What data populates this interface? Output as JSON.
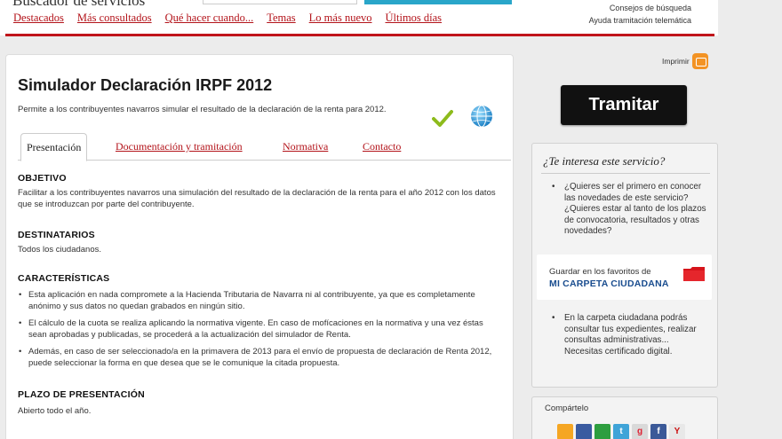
{
  "header": {
    "cut_title": "Buscador de servicios",
    "nav": [
      "Destacados",
      "Más consultados",
      "Qué hacer cuando...",
      "Temas",
      "Lo más nuevo",
      "Últimos días"
    ],
    "links": [
      "Consejos de búsqueda",
      "Ayuda tramitación telemática"
    ]
  },
  "page": {
    "title": "Simulador Declaración IRPF 2012",
    "description": "Permite a los contribuyentes navarros simular el resultado de la declaración de la renta para 2012.",
    "tabs": [
      "Presentación",
      "Documentación y tramitación",
      "Normativa",
      "Contacto"
    ]
  },
  "sections": {
    "objetivo": {
      "heading": "OBJETIVO",
      "text": "Facilitar a los contribuyentes navarros una simulación del resultado de la declaración de la renta para el año 2012 con los datos que se introduzcan por parte del contribuyente."
    },
    "destinatarios": {
      "heading": "DESTINATARIOS",
      "text": "Todos los ciudadanos."
    },
    "caracteristicas": {
      "heading": "CARACTERÍSTICAS",
      "items": [
        "Esta aplicación en nada compromete a la Hacienda Tributaria de Navarra ni al contribuyente, ya que es completamente anónimo y sus datos no quedan grabados en ningún sitio.",
        "El cálculo de la cuota se realiza aplicando la normativa vigente. En caso de mofícaciones en la normativa y una vez éstas sean aprobadas y publicadas, se procederá a la actualización del simulador de Renta.",
        "Además, en caso de ser seleccionado/a en la primavera de 2013 para el envío de propuesta de declaración de Renta 2012, puede seleccionar la forma en que desea que se le comunique la citada propuesta."
      ]
    },
    "plazo": {
      "heading": "PLAZO DE PRESENTACIÓN",
      "text": "Abierto todo el año."
    }
  },
  "sidebar": {
    "print_label": "Imprimir",
    "tramitar_label": "Tramitar",
    "interest": {
      "title": "¿Te interesa este servicio?",
      "bullet1": "¿Quieres ser el primero en conocer las novedades de este servicio? ¿Quieres estar al tanto de los plazos de convocatoria, resultados y otras novedades?",
      "fav_label": "Guardar en los favoritos de",
      "fav_link": "MI CARPETA CIUDADANA",
      "bullet2": "En la carpeta ciudadana podrás consultar tus expedientes, realizar consultas administrativas... Necesitas certificado digital."
    },
    "share": {
      "label": "Compártelo",
      "icons": [
        {
          "name": "rss",
          "glyph": "",
          "color": "#f5a623"
        },
        {
          "name": "delicious",
          "glyph": "",
          "color": "#3a5ba0"
        },
        {
          "name": "meneame",
          "glyph": "",
          "color": "#2e9e3f"
        },
        {
          "name": "twitter",
          "glyph": "t",
          "color": "#3fa4d8"
        },
        {
          "name": "google",
          "glyph": "g",
          "color": "#d9d9d9"
        },
        {
          "name": "facebook",
          "glyph": "f",
          "color": "#3b5998"
        },
        {
          "name": "yahoo",
          "glyph": "Y",
          "color": "#e8e8e8"
        }
      ]
    }
  }
}
